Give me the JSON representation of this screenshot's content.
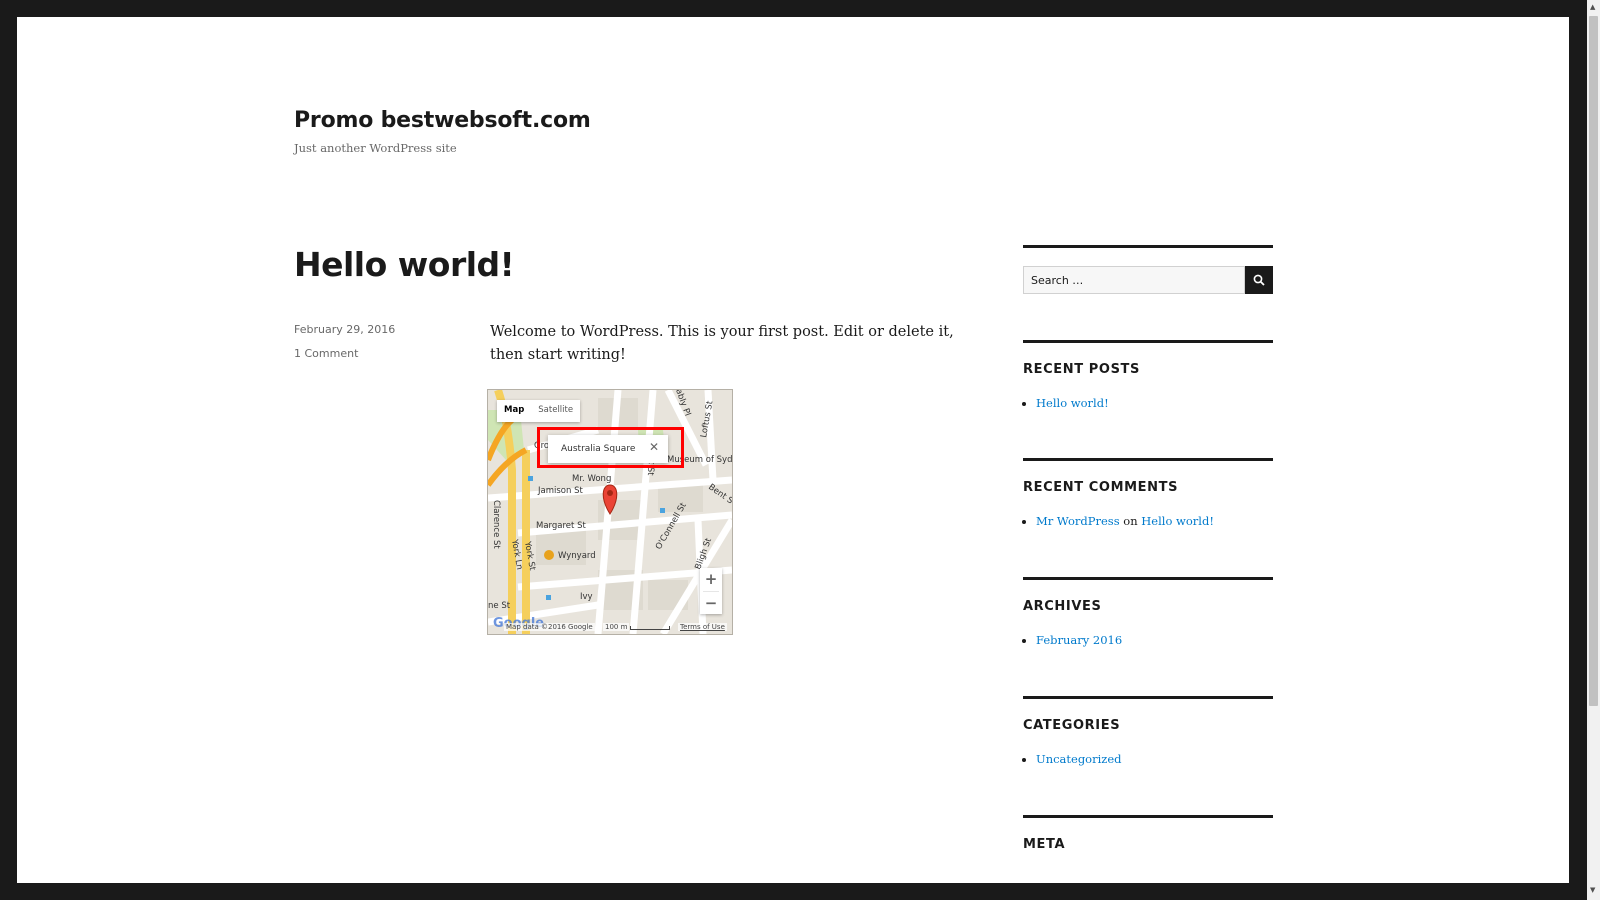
{
  "site": {
    "title": "Promo bestwebsoft.com",
    "tagline": "Just another WordPress site"
  },
  "post": {
    "title": "Hello world!",
    "date": "February 29, 2016",
    "comments": "1 Comment",
    "content": "Welcome to WordPress. This is your first post. Edit or delete it, then start writing!"
  },
  "map": {
    "type_map": "Map",
    "type_satellite": "Satellite",
    "info_label": "Australia Square",
    "info_close": "✕",
    "zoom_in": "+",
    "zoom_out": "−",
    "google_logo": "Google",
    "copyright": "Map data ©2016 Google",
    "scale": "100 m",
    "terms": "Terms of Use",
    "streets": {
      "jamison": "Jamison St",
      "margaret": "Margaret St",
      "wynyard": "Wynyard",
      "clarence": "Clarence St",
      "york": "York St",
      "york_ln": "York Ln",
      "pitt": "Pitt St",
      "oconnell": "O'Connell St",
      "bligh": "Bligh St",
      "bent": "Bent St",
      "loftus": "Loftus St",
      "museum": "Museum of Sydn",
      "mr_wong": "Mr. Wong",
      "ivy": "Ivy",
      "ne_st": "ne St",
      "gros": "Gros",
      "ably_pl": "ably Pl"
    }
  },
  "sidebar": {
    "search_placeholder": "Search …",
    "recent_posts": {
      "title": "RECENT POSTS",
      "items": [
        "Hello world!"
      ]
    },
    "recent_comments": {
      "title": "RECENT COMMENTS",
      "author": "Mr WordPress",
      "on": "on",
      "post": "Hello world!"
    },
    "archives": {
      "title": "ARCHIVES",
      "items": [
        "February 2016"
      ]
    },
    "categories": {
      "title": "CATEGORIES",
      "items": [
        "Uncategorized"
      ]
    },
    "meta": {
      "title": "META"
    }
  },
  "colors": {
    "link": "#007acc",
    "text": "#1a1a1a",
    "highlight": "#ff0000"
  }
}
